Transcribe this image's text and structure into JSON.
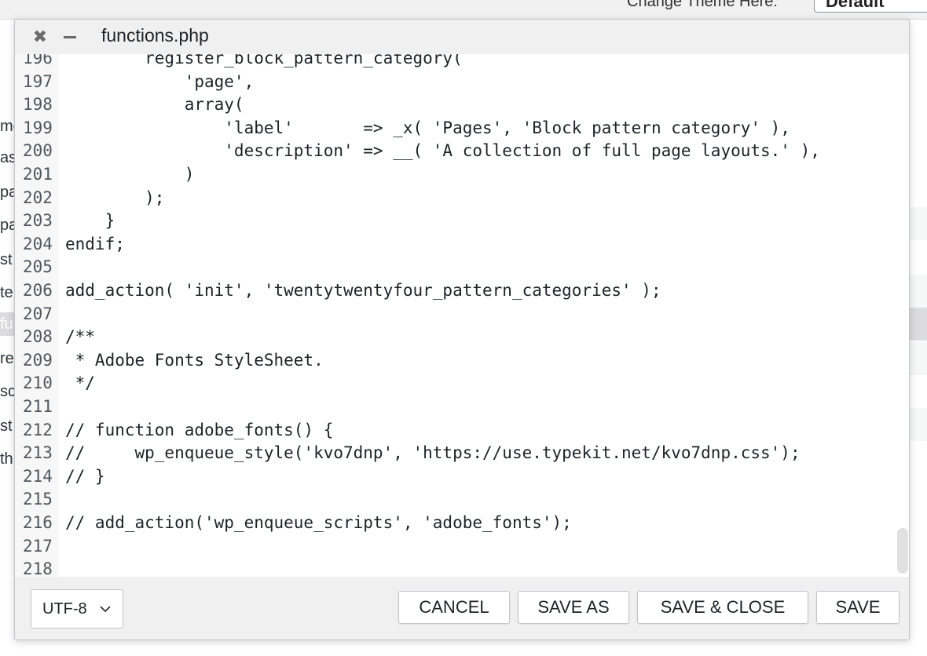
{
  "background": {
    "change_theme_label": "Change Theme Here:",
    "theme_select_value": "Default",
    "file_fragments": [
      "me",
      "as",
      "pa",
      "pa",
      "st",
      "te",
      "fu",
      "re",
      "sc",
      "st",
      "th"
    ]
  },
  "dialog": {
    "title": "functions.php",
    "close_icon": "close-icon",
    "minimize_icon": "minimize-icon"
  },
  "editor": {
    "lines": [
      {
        "num": "196",
        "code": "        register_block_pattern_category("
      },
      {
        "num": "197",
        "code": "            'page',"
      },
      {
        "num": "198",
        "code": "            array("
      },
      {
        "num": "199",
        "code": "                'label'       => _x( 'Pages', 'Block pattern category' ),"
      },
      {
        "num": "200",
        "code": "                'description' => __( 'A collection of full page layouts.' ),"
      },
      {
        "num": "201",
        "code": "            )"
      },
      {
        "num": "202",
        "code": "        );"
      },
      {
        "num": "203",
        "code": "    }"
      },
      {
        "num": "204",
        "code": "endif;"
      },
      {
        "num": "205",
        "code": ""
      },
      {
        "num": "206",
        "code": "add_action( 'init', 'twentytwentyfour_pattern_categories' );"
      },
      {
        "num": "207",
        "code": ""
      },
      {
        "num": "208",
        "code": "/**"
      },
      {
        "num": "209",
        "code": " * Adobe Fonts StyleSheet."
      },
      {
        "num": "210",
        "code": " */"
      },
      {
        "num": "211",
        "code": ""
      },
      {
        "num": "212",
        "code": "// function adobe_fonts() {"
      },
      {
        "num": "213",
        "code": "//     wp_enqueue_style('kvo7dnp', 'https://use.typekit.net/kvo7dnp.css');"
      },
      {
        "num": "214",
        "code": "// }"
      },
      {
        "num": "215",
        "code": ""
      },
      {
        "num": "216",
        "code": "// add_action('wp_enqueue_scripts', 'adobe_fonts');"
      },
      {
        "num": "217",
        "code": ""
      },
      {
        "num": "218",
        "code": ""
      }
    ]
  },
  "footer": {
    "encoding": "UTF-8",
    "encoding_icon": "chevron-down-icon",
    "cancel": "CANCEL",
    "save_as": "SAVE AS",
    "save_close": "SAVE & CLOSE",
    "save": "SAVE"
  }
}
